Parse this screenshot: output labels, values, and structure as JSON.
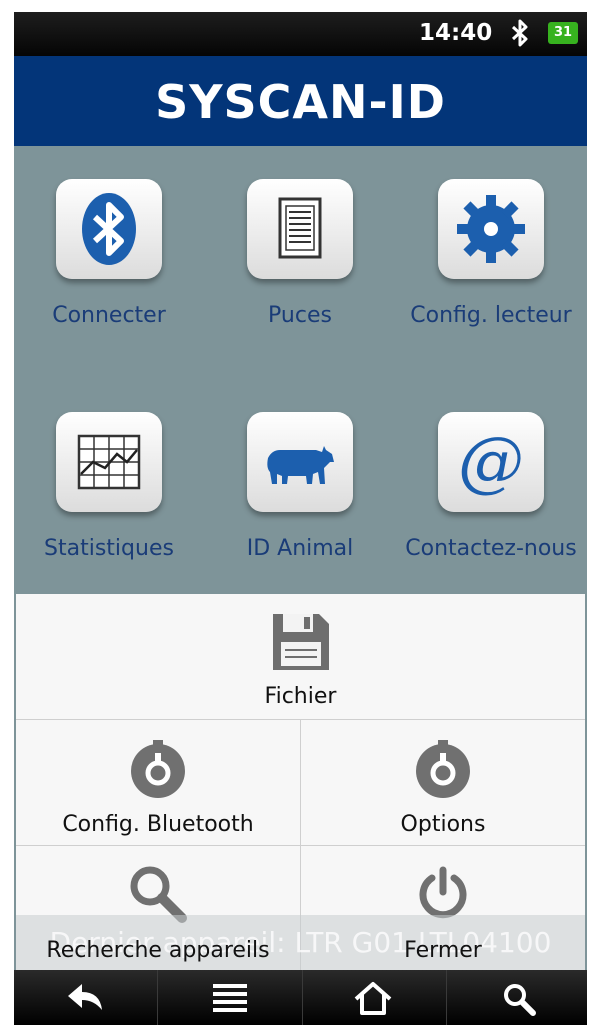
{
  "status_bar": {
    "time": "14:40",
    "battery_level": "31"
  },
  "app": {
    "title": "SYSCAN-ID"
  },
  "grid": {
    "items": [
      {
        "label": "Connecter",
        "icon": "bluetooth-icon"
      },
      {
        "label": "Puces",
        "icon": "document-list-icon"
      },
      {
        "label": "Config. lecteur",
        "icon": "gear-icon"
      },
      {
        "label": "Statistiques",
        "icon": "chart-icon"
      },
      {
        "label": "ID Animal",
        "icon": "cow-icon"
      },
      {
        "label": "Contactez-nous",
        "icon": "at-sign-icon"
      }
    ]
  },
  "options_menu": {
    "items": [
      {
        "label": "Fichier",
        "icon": "save-icon"
      },
      {
        "label": "Config. Bluetooth",
        "icon": "dial-icon"
      },
      {
        "label": "Options",
        "icon": "dial-icon"
      },
      {
        "label": "Recherche appareils",
        "icon": "search-icon"
      },
      {
        "label": "Fermer",
        "icon": "power-icon"
      }
    ]
  },
  "background_status_text": "Dernier appareil: LTR G01 LTL04100",
  "nav_bar": {
    "buttons": [
      "back-icon",
      "menu-icon",
      "home-icon",
      "search-icon"
    ]
  },
  "colors": {
    "title_bar": "#033579",
    "background": "#7e9499",
    "label_text": "#1a3c78",
    "accent": "#1c5fae"
  }
}
